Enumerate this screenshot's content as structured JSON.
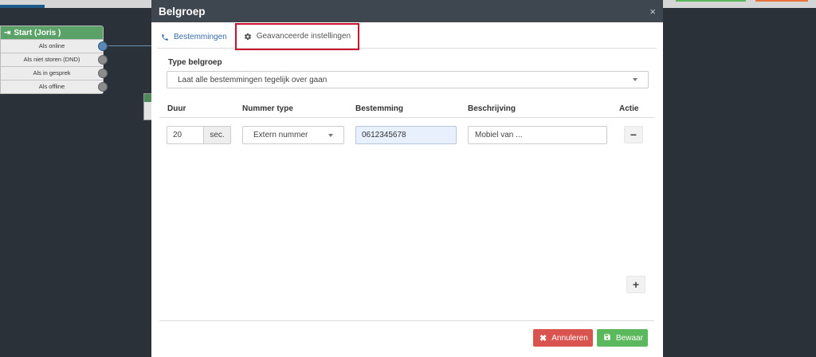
{
  "background": {
    "flow_node": {
      "title": "Start (Joris )",
      "rows": [
        "Als online",
        "Als niet storen (DND)",
        "Als in gesprek",
        "Als offline"
      ]
    }
  },
  "modal": {
    "title": "Belgroep",
    "close_label": "×",
    "tabs": [
      {
        "label": "Bestemmingen",
        "icon": "phone-icon"
      },
      {
        "label": "Geavanceerde instellingen",
        "icon": "gear-icon"
      }
    ],
    "type_label": "Type belgroep",
    "type_value": "Laat alle bestemmingen tegelijk over gaan",
    "table": {
      "headers": [
        "Duur",
        "Nummer type",
        "Bestemming",
        "Beschrijving",
        "Actie"
      ],
      "row": {
        "duur": "20",
        "duur_unit": "sec.",
        "nummer_type": "Extern nummer",
        "bestemming": "0612345678",
        "beschrijving": "Mobiel van ..."
      }
    },
    "remove_label": "−",
    "add_label": "+",
    "buttons": {
      "cancel": "Annuleren",
      "save": "Bewaar"
    }
  },
  "colors": {
    "header_bg": "#3e4650",
    "accent": "#3a6ea5",
    "highlight": "#c8102e",
    "danger": "#d9534f",
    "success": "#5cb85c"
  }
}
